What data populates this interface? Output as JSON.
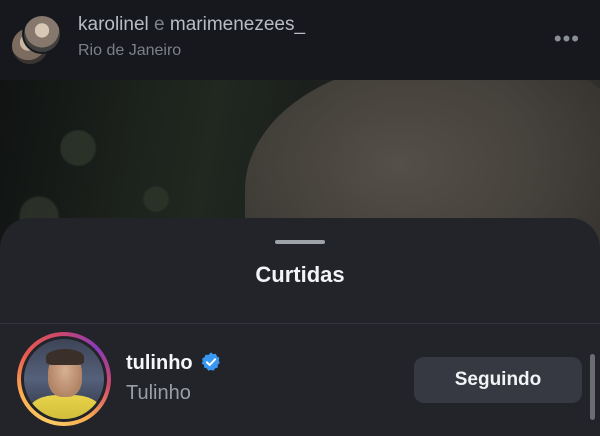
{
  "post_header": {
    "accounts": "karolinel e marimenezees_",
    "location": "Rio de Janeiro",
    "more_icon": "ellipsis-icon"
  },
  "likes_sheet": {
    "title": "Curtidas",
    "items": [
      {
        "username": "tulinho",
        "full_name": "Tulinho",
        "verified": true,
        "verified_color": "#3897f0",
        "story_ring": true,
        "button_label": "Seguindo"
      }
    ]
  }
}
